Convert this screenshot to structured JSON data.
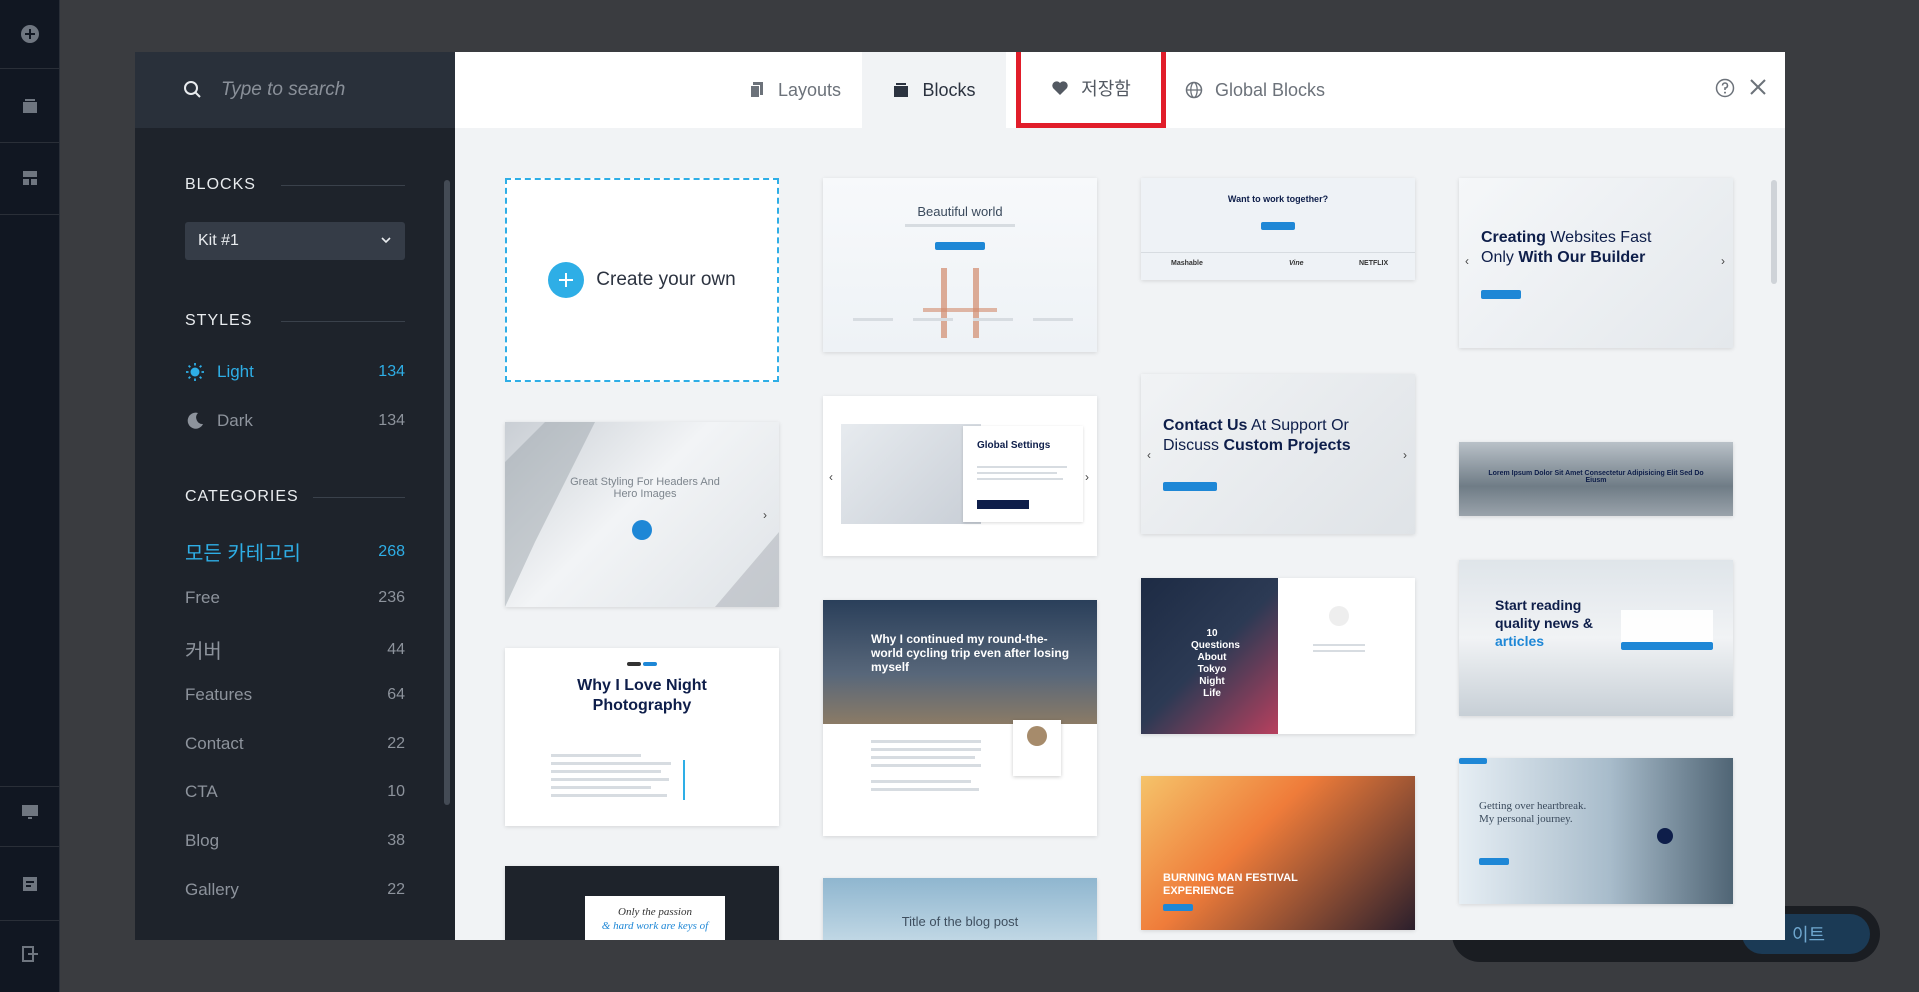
{
  "search": {
    "placeholder": "Type to search"
  },
  "tabs": [
    {
      "label": "Layouts"
    },
    {
      "label": "Blocks"
    },
    {
      "label": "저장함"
    },
    {
      "label": "Global Blocks"
    }
  ],
  "sidebar": {
    "blocks_title": "BLOCKS",
    "kit_select": "Kit #1",
    "styles_title": "STYLES",
    "styles": [
      {
        "label": "Light",
        "count": "134"
      },
      {
        "label": "Dark",
        "count": "134"
      }
    ],
    "categories_title": "CATEGORIES",
    "categories": [
      {
        "label": "모든 카테고리",
        "count": "268"
      },
      {
        "label": "Free",
        "count": "236"
      },
      {
        "label": "커버",
        "count": "44"
      },
      {
        "label": "Features",
        "count": "64"
      },
      {
        "label": "Contact",
        "count": "22"
      },
      {
        "label": "CTA",
        "count": "10"
      },
      {
        "label": "Blog",
        "count": "38"
      },
      {
        "label": "Gallery",
        "count": "22"
      }
    ]
  },
  "grid": {
    "create_label": "Create your own",
    "thumbs": {
      "beautiful_world": "Beautiful world",
      "great_styling": "Great Styling For Headers And Hero Images",
      "why_night": "Why I Love Night Photography",
      "passion_1": "Only the passion",
      "passion_2": "& hard work are keys of",
      "global_settings": "Global Settings",
      "cycling": "Why I continued my round-the-world cycling trip even after losing myself",
      "blog_post": "Title of the blog post",
      "work_together": "Want to work together?",
      "logos": [
        "Mashable",
        "Vine",
        "NETFLIX"
      ],
      "contact_a": "Contact Us",
      "contact_b": " At Support Or Discuss ",
      "contact_c": "Custom Projects",
      "tokyo": "10 Questions About Tokyo Night Life",
      "burning": "BURNING MAN FESTIVAL EXPERIENCE",
      "creating_a": "Creating",
      "creating_b": " Websites Fast Only ",
      "creating_c": "With Our Builder",
      "lorem": "Lorem Ipsum Dolor Sit Amet Consectetur Adipisicing Elit Sed Do Eiusm",
      "start_reading_a": "Start reading quality news & ",
      "start_reading_b": "articles",
      "getting_over": "Getting over heartbreak. My personal journey."
    }
  },
  "bottom_bar": {
    "button": "이트"
  },
  "colors": {
    "accent": "#2eaee6",
    "highlight": "#e11d2a",
    "sidebar": "#1e232b"
  }
}
